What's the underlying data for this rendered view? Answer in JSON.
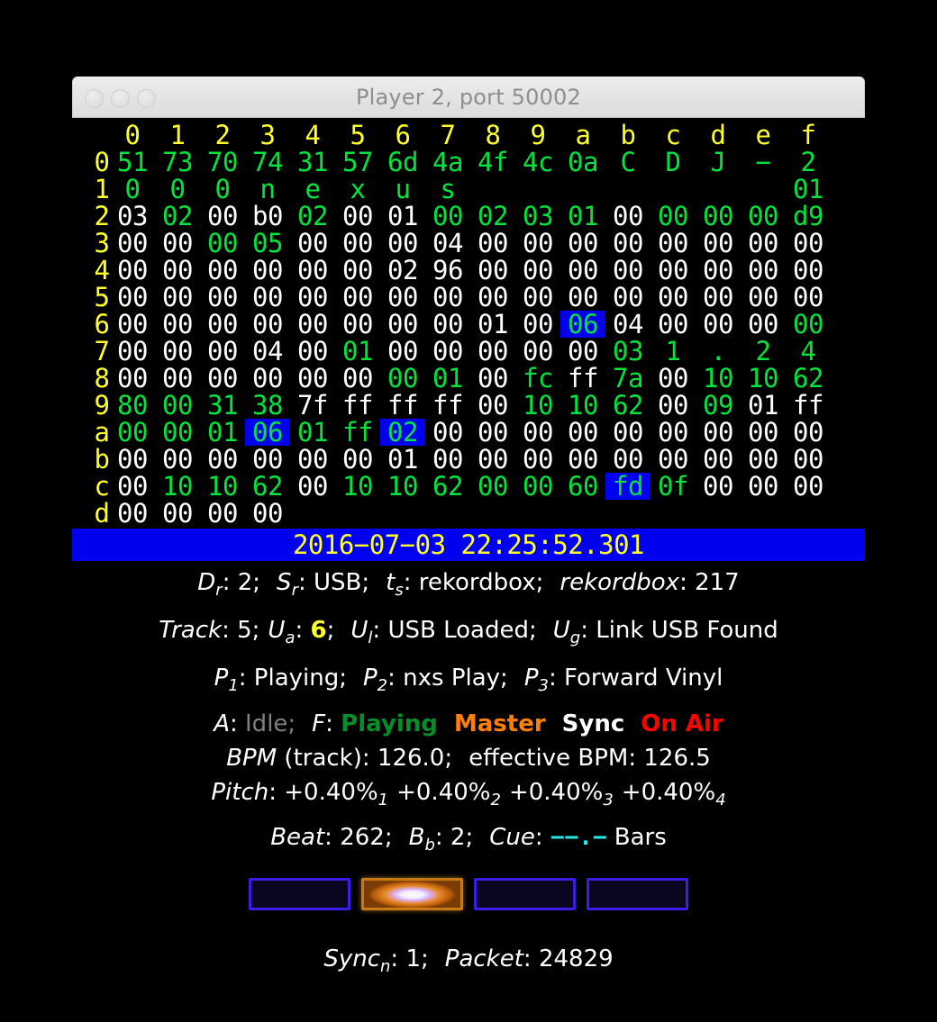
{
  "window": {
    "title": "Player 2, port 50002",
    "traffic_lights": [
      "close",
      "minimize",
      "zoom"
    ]
  },
  "hexdump": {
    "column_headers": [
      "0",
      "1",
      "2",
      "3",
      "4",
      "5",
      "6",
      "7",
      "8",
      "9",
      "a",
      "b",
      "c",
      "d",
      "e",
      "f"
    ],
    "rows": [
      {
        "label": "0",
        "cells": [
          {
            "t": "51",
            "c": "g"
          },
          {
            "t": "73",
            "c": "g"
          },
          {
            "t": "70",
            "c": "g"
          },
          {
            "t": "74",
            "c": "g"
          },
          {
            "t": "31",
            "c": "g"
          },
          {
            "t": "57",
            "c": "g"
          },
          {
            "t": "6d",
            "c": "g"
          },
          {
            "t": "4a",
            "c": "g"
          },
          {
            "t": "4f",
            "c": "g"
          },
          {
            "t": "4c",
            "c": "g"
          },
          {
            "t": "0a",
            "c": "g"
          },
          {
            "t": "C",
            "c": "g"
          },
          {
            "t": "D",
            "c": "g"
          },
          {
            "t": "J",
            "c": "g"
          },
          {
            "t": "−",
            "c": "g"
          },
          {
            "t": "2",
            "c": "g"
          }
        ]
      },
      {
        "label": "1",
        "cells": [
          {
            "t": "0",
            "c": "g"
          },
          {
            "t": "0",
            "c": "g"
          },
          {
            "t": "0",
            "c": "g"
          },
          {
            "t": "n",
            "c": "g"
          },
          {
            "t": "e",
            "c": "g"
          },
          {
            "t": "x",
            "c": "g"
          },
          {
            "t": "u",
            "c": "g"
          },
          {
            "t": "s",
            "c": "g"
          },
          {
            "t": "",
            "c": "g"
          },
          {
            "t": "",
            "c": "g"
          },
          {
            "t": "",
            "c": "g"
          },
          {
            "t": "",
            "c": "g"
          },
          {
            "t": "",
            "c": "g"
          },
          {
            "t": "",
            "c": "g"
          },
          {
            "t": "",
            "c": "g"
          },
          {
            "t": "01",
            "c": "g"
          }
        ]
      },
      {
        "label": "2",
        "cells": [
          {
            "t": "03",
            "c": "w"
          },
          {
            "t": "02",
            "c": "g"
          },
          {
            "t": "00",
            "c": "w"
          },
          {
            "t": "b0",
            "c": "w"
          },
          {
            "t": "02",
            "c": "g"
          },
          {
            "t": "00",
            "c": "w"
          },
          {
            "t": "01",
            "c": "w"
          },
          {
            "t": "00",
            "c": "g"
          },
          {
            "t": "02",
            "c": "g"
          },
          {
            "t": "03",
            "c": "g"
          },
          {
            "t": "01",
            "c": "g"
          },
          {
            "t": "00",
            "c": "w"
          },
          {
            "t": "00",
            "c": "g"
          },
          {
            "t": "00",
            "c": "g"
          },
          {
            "t": "00",
            "c": "g"
          },
          {
            "t": "d9",
            "c": "g"
          }
        ]
      },
      {
        "label": "3",
        "cells": [
          {
            "t": "00",
            "c": "w"
          },
          {
            "t": "00",
            "c": "w"
          },
          {
            "t": "00",
            "c": "g"
          },
          {
            "t": "05",
            "c": "g"
          },
          {
            "t": "00",
            "c": "w"
          },
          {
            "t": "00",
            "c": "w"
          },
          {
            "t": "00",
            "c": "w"
          },
          {
            "t": "04",
            "c": "w"
          },
          {
            "t": "00",
            "c": "w"
          },
          {
            "t": "00",
            "c": "w"
          },
          {
            "t": "00",
            "c": "w"
          },
          {
            "t": "00",
            "c": "w"
          },
          {
            "t": "00",
            "c": "w"
          },
          {
            "t": "00",
            "c": "w"
          },
          {
            "t": "00",
            "c": "w"
          },
          {
            "t": "00",
            "c": "w"
          }
        ]
      },
      {
        "label": "4",
        "cells": [
          {
            "t": "00",
            "c": "w"
          },
          {
            "t": "00",
            "c": "w"
          },
          {
            "t": "00",
            "c": "w"
          },
          {
            "t": "00",
            "c": "w"
          },
          {
            "t": "00",
            "c": "w"
          },
          {
            "t": "00",
            "c": "w"
          },
          {
            "t": "02",
            "c": "w"
          },
          {
            "t": "96",
            "c": "w"
          },
          {
            "t": "00",
            "c": "w"
          },
          {
            "t": "00",
            "c": "w"
          },
          {
            "t": "00",
            "c": "w"
          },
          {
            "t": "00",
            "c": "w"
          },
          {
            "t": "00",
            "c": "w"
          },
          {
            "t": "00",
            "c": "w"
          },
          {
            "t": "00",
            "c": "w"
          },
          {
            "t": "00",
            "c": "w"
          }
        ]
      },
      {
        "label": "5",
        "cells": [
          {
            "t": "00",
            "c": "w"
          },
          {
            "t": "00",
            "c": "w"
          },
          {
            "t": "00",
            "c": "w"
          },
          {
            "t": "00",
            "c": "w"
          },
          {
            "t": "00",
            "c": "w"
          },
          {
            "t": "00",
            "c": "w"
          },
          {
            "t": "00",
            "c": "w"
          },
          {
            "t": "00",
            "c": "w"
          },
          {
            "t": "00",
            "c": "w"
          },
          {
            "t": "00",
            "c": "w"
          },
          {
            "t": "00",
            "c": "w"
          },
          {
            "t": "00",
            "c": "w"
          },
          {
            "t": "00",
            "c": "w"
          },
          {
            "t": "00",
            "c": "w"
          },
          {
            "t": "00",
            "c": "w"
          },
          {
            "t": "00",
            "c": "w"
          }
        ]
      },
      {
        "label": "6",
        "cells": [
          {
            "t": "00",
            "c": "w"
          },
          {
            "t": "00",
            "c": "w"
          },
          {
            "t": "00",
            "c": "w"
          },
          {
            "t": "00",
            "c": "w"
          },
          {
            "t": "00",
            "c": "w"
          },
          {
            "t": "00",
            "c": "w"
          },
          {
            "t": "00",
            "c": "w"
          },
          {
            "t": "00",
            "c": "w"
          },
          {
            "t": "01",
            "c": "w"
          },
          {
            "t": "00",
            "c": "w"
          },
          {
            "t": "06",
            "c": "hl"
          },
          {
            "t": "04",
            "c": "w"
          },
          {
            "t": "00",
            "c": "w"
          },
          {
            "t": "00",
            "c": "w"
          },
          {
            "t": "00",
            "c": "w"
          },
          {
            "t": "00",
            "c": "g"
          }
        ]
      },
      {
        "label": "7",
        "cells": [
          {
            "t": "00",
            "c": "w"
          },
          {
            "t": "00",
            "c": "w"
          },
          {
            "t": "00",
            "c": "w"
          },
          {
            "t": "04",
            "c": "w"
          },
          {
            "t": "00",
            "c": "w"
          },
          {
            "t": "01",
            "c": "g"
          },
          {
            "t": "00",
            "c": "w"
          },
          {
            "t": "00",
            "c": "w"
          },
          {
            "t": "00",
            "c": "w"
          },
          {
            "t": "00",
            "c": "w"
          },
          {
            "t": "00",
            "c": "w"
          },
          {
            "t": "03",
            "c": "g"
          },
          {
            "t": "1",
            "c": "g"
          },
          {
            "t": ".",
            "c": "g"
          },
          {
            "t": "2",
            "c": "g"
          },
          {
            "t": "4",
            "c": "g"
          }
        ]
      },
      {
        "label": "8",
        "cells": [
          {
            "t": "00",
            "c": "w"
          },
          {
            "t": "00",
            "c": "w"
          },
          {
            "t": "00",
            "c": "w"
          },
          {
            "t": "00",
            "c": "w"
          },
          {
            "t": "00",
            "c": "w"
          },
          {
            "t": "00",
            "c": "w"
          },
          {
            "t": "00",
            "c": "g"
          },
          {
            "t": "01",
            "c": "g"
          },
          {
            "t": "00",
            "c": "w"
          },
          {
            "t": "fc",
            "c": "g"
          },
          {
            "t": "ff",
            "c": "w"
          },
          {
            "t": "7a",
            "c": "g"
          },
          {
            "t": "00",
            "c": "w"
          },
          {
            "t": "10",
            "c": "g"
          },
          {
            "t": "10",
            "c": "g"
          },
          {
            "t": "62",
            "c": "g"
          }
        ]
      },
      {
        "label": "9",
        "cells": [
          {
            "t": "80",
            "c": "g"
          },
          {
            "t": "00",
            "c": "g"
          },
          {
            "t": "31",
            "c": "g"
          },
          {
            "t": "38",
            "c": "g"
          },
          {
            "t": "7f",
            "c": "w"
          },
          {
            "t": "ff",
            "c": "w"
          },
          {
            "t": "ff",
            "c": "w"
          },
          {
            "t": "ff",
            "c": "w"
          },
          {
            "t": "00",
            "c": "w"
          },
          {
            "t": "10",
            "c": "g"
          },
          {
            "t": "10",
            "c": "g"
          },
          {
            "t": "62",
            "c": "g"
          },
          {
            "t": "00",
            "c": "w"
          },
          {
            "t": "09",
            "c": "g"
          },
          {
            "t": "01",
            "c": "w"
          },
          {
            "t": "ff",
            "c": "w"
          }
        ]
      },
      {
        "label": "a",
        "cells": [
          {
            "t": "00",
            "c": "g"
          },
          {
            "t": "00",
            "c": "g"
          },
          {
            "t": "01",
            "c": "g"
          },
          {
            "t": "06",
            "c": "hl"
          },
          {
            "t": "01",
            "c": "g"
          },
          {
            "t": "ff",
            "c": "g"
          },
          {
            "t": "02",
            "c": "hl"
          },
          {
            "t": "00",
            "c": "w"
          },
          {
            "t": "00",
            "c": "w"
          },
          {
            "t": "00",
            "c": "w"
          },
          {
            "t": "00",
            "c": "w"
          },
          {
            "t": "00",
            "c": "w"
          },
          {
            "t": "00",
            "c": "w"
          },
          {
            "t": "00",
            "c": "w"
          },
          {
            "t": "00",
            "c": "w"
          },
          {
            "t": "00",
            "c": "w"
          }
        ]
      },
      {
        "label": "b",
        "cells": [
          {
            "t": "00",
            "c": "w"
          },
          {
            "t": "00",
            "c": "w"
          },
          {
            "t": "00",
            "c": "w"
          },
          {
            "t": "00",
            "c": "w"
          },
          {
            "t": "00",
            "c": "w"
          },
          {
            "t": "00",
            "c": "w"
          },
          {
            "t": "01",
            "c": "w"
          },
          {
            "t": "00",
            "c": "w"
          },
          {
            "t": "00",
            "c": "w"
          },
          {
            "t": "00",
            "c": "w"
          },
          {
            "t": "00",
            "c": "w"
          },
          {
            "t": "00",
            "c": "w"
          },
          {
            "t": "00",
            "c": "w"
          },
          {
            "t": "00",
            "c": "w"
          },
          {
            "t": "00",
            "c": "w"
          },
          {
            "t": "00",
            "c": "w"
          }
        ]
      },
      {
        "label": "c",
        "cells": [
          {
            "t": "00",
            "c": "w"
          },
          {
            "t": "10",
            "c": "g"
          },
          {
            "t": "10",
            "c": "g"
          },
          {
            "t": "62",
            "c": "g"
          },
          {
            "t": "00",
            "c": "w"
          },
          {
            "t": "10",
            "c": "g"
          },
          {
            "t": "10",
            "c": "g"
          },
          {
            "t": "62",
            "c": "g"
          },
          {
            "t": "00",
            "c": "g"
          },
          {
            "t": "00",
            "c": "g"
          },
          {
            "t": "60",
            "c": "g"
          },
          {
            "t": "fd",
            "c": "hl"
          },
          {
            "t": "0f",
            "c": "g"
          },
          {
            "t": "00",
            "c": "w"
          },
          {
            "t": "00",
            "c": "w"
          },
          {
            "t": "00",
            "c": "w"
          }
        ]
      },
      {
        "label": "d",
        "cells": [
          {
            "t": "00",
            "c": "w"
          },
          {
            "t": "00",
            "c": "w"
          },
          {
            "t": "00",
            "c": "w"
          },
          {
            "t": "00",
            "c": "w"
          },
          {
            "t": "",
            "c": "w"
          },
          {
            "t": "",
            "c": "w"
          },
          {
            "t": "",
            "c": "w"
          },
          {
            "t": "",
            "c": "w"
          },
          {
            "t": "",
            "c": "w"
          },
          {
            "t": "",
            "c": "w"
          },
          {
            "t": "",
            "c": "w"
          },
          {
            "t": "",
            "c": "w"
          },
          {
            "t": "",
            "c": "w"
          },
          {
            "t": "",
            "c": "w"
          },
          {
            "t": "",
            "c": "w"
          },
          {
            "t": "",
            "c": "w"
          }
        ]
      }
    ]
  },
  "timestamp": "2016−07−03 22:25:52.301",
  "status": {
    "line1": {
      "device_label": "D",
      "device_sub": "r",
      "device_value": "2;",
      "slot_label": "S",
      "slot_sub": "r",
      "slot_value": "USB;",
      "track_type_label": "t",
      "track_type_sub": "s",
      "track_type_value": "rekordbox;",
      "rekordbox_label": "rekordbox",
      "rekordbox_value": "217"
    },
    "line2": {
      "track_label": "Track",
      "track_value": "5;",
      "ua_label": "U",
      "ua_sub": "a",
      "ua_value": "6",
      "ua_suffix": ";",
      "ul_label": "U",
      "ul_sub": "l",
      "ul_value": "USB Loaded;",
      "ug_label": "U",
      "ug_sub": "g",
      "ug_value": "Link USB Found"
    },
    "line3": {
      "p1_label": "P",
      "p1_sub": "1",
      "p1_value": "Playing;",
      "p2_label": "P",
      "p2_sub": "2",
      "p2_value": "nxs Play;",
      "p3_label": "P",
      "p3_sub": "3",
      "p3_value": "Forward Vinyl"
    },
    "line4": {
      "a_label": "A",
      "a_value": "Idle;",
      "f_label": "F",
      "f_value": "Playing",
      "master": "Master",
      "sync": "Sync",
      "on_air": "On Air"
    },
    "line5": {
      "bpm_label": "BPM",
      "bpm_qualifier": "(track):",
      "bpm_value": "126.0;",
      "effective_label": "effective BPM:",
      "effective_value": "126.5"
    },
    "line6": {
      "pitch_label": "Pitch",
      "pitch_colon": ":",
      "pitches": [
        {
          "value": "+0.40%",
          "index": "1"
        },
        {
          "value": "+0.40%",
          "index": "2"
        },
        {
          "value": "+0.40%",
          "index": "3"
        },
        {
          "value": "+0.40%",
          "index": "4"
        }
      ]
    },
    "line7": {
      "beat_label": "Beat",
      "beat_value": "262;",
      "bb_label": "B",
      "bb_sub": "b",
      "bb_value": "2;",
      "cue_label": "Cue",
      "cue_value": "−−.−",
      "cue_unit": "Bars"
    },
    "line8": {
      "sync_label": "Sync",
      "sync_sub": "n",
      "sync_value": "1;",
      "packet_label": "Packet",
      "packet_value": "24829"
    }
  },
  "beat_indicators": {
    "count": 4,
    "active_index": 1,
    "on_color": "#e8892a",
    "off_border_color": "#3a1ee6",
    "off_fill_color": "#0a0620"
  },
  "colors": {
    "background": "#000000",
    "hex_offset": "#ffff2a",
    "hex_white": "#ffffff",
    "hex_green": "#00e53d",
    "highlight_bg": "#0000ee",
    "timestamp_bar_bg": "#0000ee",
    "timestamp_text": "#ffff2a",
    "status_idle": "#808080",
    "status_playing": "#008f2a",
    "status_master": "#ff8000",
    "status_sync": "#ffffff",
    "status_on_air": "#ff0000",
    "cue_cyan": "#2ae5e5",
    "title_text": "#8e8e8e"
  }
}
